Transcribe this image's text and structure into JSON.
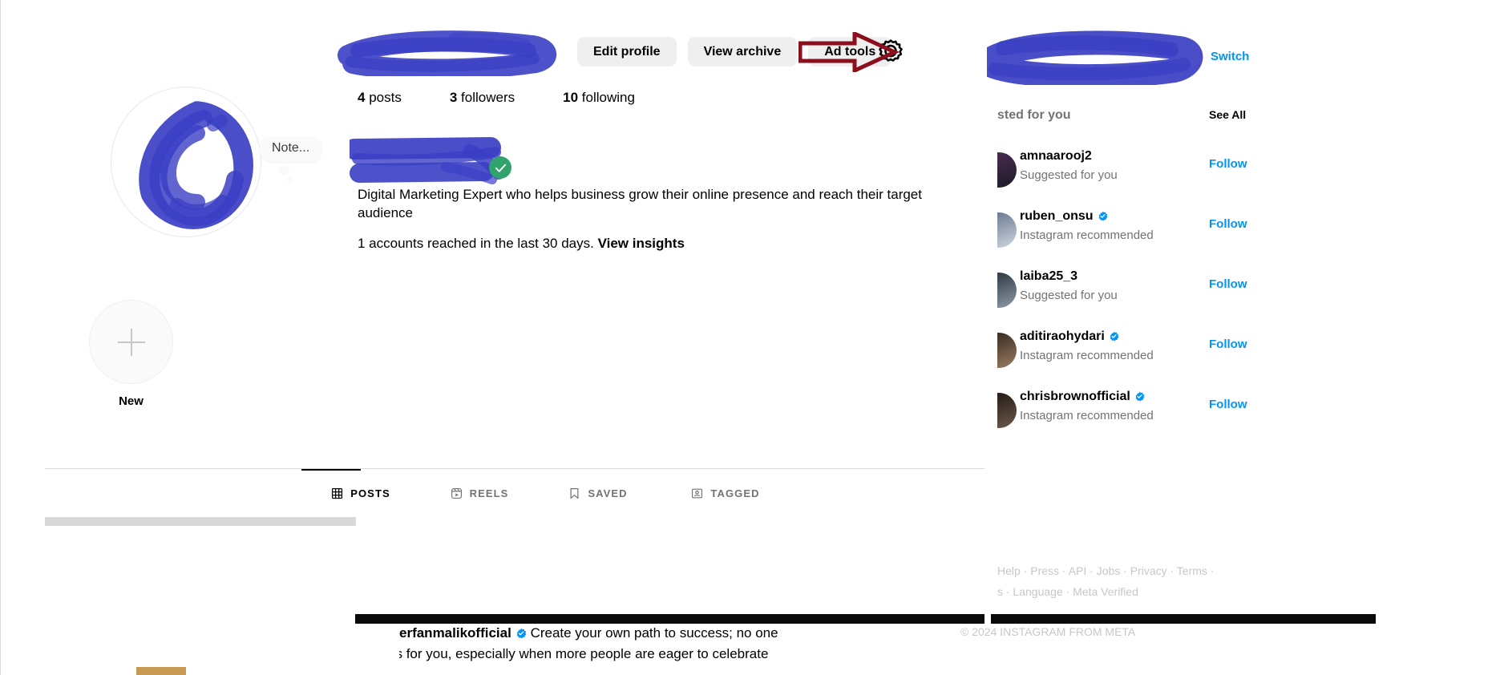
{
  "profile": {
    "username_redacted": true,
    "note_label": "Note...",
    "buttons": {
      "edit_profile": "Edit profile",
      "view_archive": "View archive",
      "ad_tools": "Ad tools"
    },
    "settings_icon": "gear-icon",
    "stats": [
      {
        "value": "4",
        "label": "posts"
      },
      {
        "value": "3",
        "label": "followers"
      },
      {
        "value": "10",
        "label": "following"
      }
    ],
    "display_name_redacted": true,
    "verified_badge": "green-check",
    "bio": "Digital Marketing Expert who helps business grow their online presence and reach their target audience",
    "insights_text": "1 accounts reached in the last 30 days.",
    "insights_link": "View insights",
    "highlight_new_label": "New",
    "highlight_add_icon": "plus-icon"
  },
  "annotation": {
    "type": "red-arrow",
    "color": "#8b0f1d",
    "points_to": "settings-gear-icon"
  },
  "tabs": [
    {
      "label": "POSTS",
      "icon": "grid-icon",
      "active": true
    },
    {
      "label": "REELS",
      "icon": "reels-icon",
      "active": false
    },
    {
      "label": "SAVED",
      "icon": "bookmark-icon",
      "active": false
    },
    {
      "label": "TAGGED",
      "icon": "tagged-person-icon",
      "active": false
    }
  ],
  "post_overlay": {
    "username": "erfanmalikofficial",
    "verified": true,
    "caption_line1": "Create your own path to success; no one",
    "caption_line2_prefix": "es",
    "caption_line2": "for you, especially when more people are eager to celebrate"
  },
  "sidebar": {
    "current_user_redacted": true,
    "switch_label": "Switch",
    "suggested_title": "sted for you",
    "see_all_label": "See All",
    "accounts": [
      {
        "name": "amnaarooj2",
        "verified": false,
        "subtitle": "Suggested for you",
        "action": "Follow"
      },
      {
        "name": "ruben_onsu",
        "verified": true,
        "subtitle": "Instagram recommended",
        "action": "Follow"
      },
      {
        "name": "laiba25_3",
        "verified": false,
        "subtitle": "Suggested for you",
        "action": "Follow"
      },
      {
        "name": "aditiraohydari",
        "verified": true,
        "subtitle": "Instagram recommended",
        "action": "Follow"
      },
      {
        "name": "chrisbrownofficial",
        "verified": true,
        "subtitle": "Instagram recommended",
        "action": "Follow"
      }
    ],
    "footer_line1": "Help · Press · API · Jobs · Privacy · Terms ·",
    "footer_line2": "s · Language · Meta Verified",
    "copyright": "© 2024 INSTAGRAM FROM META"
  },
  "colors": {
    "link_blue": "#0095f6",
    "verified_blue": "#0095f6",
    "annotation_red": "#8b0f1d",
    "redaction_blue": "#3b3fc4",
    "green_check": "#30a46c",
    "button_grey": "#efefef"
  }
}
